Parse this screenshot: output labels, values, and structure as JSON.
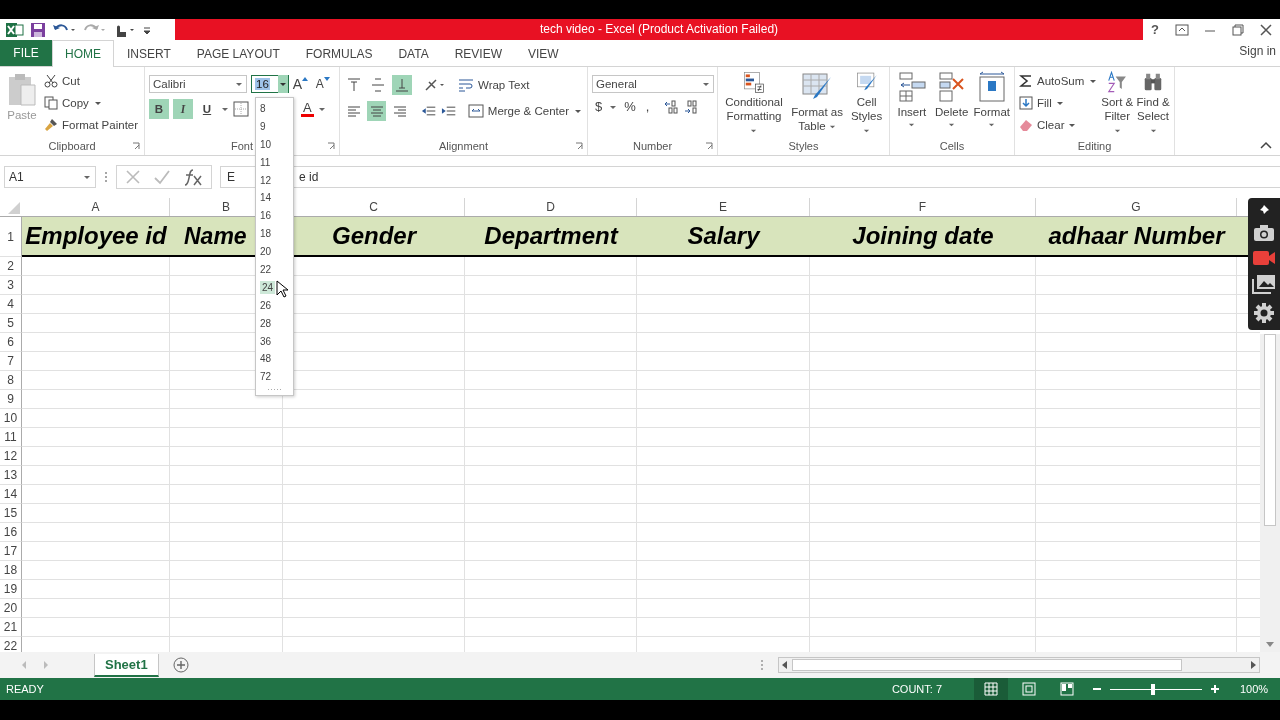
{
  "window": {
    "title": "tech video -  Excel (Product Activation Failed)",
    "help": "?"
  },
  "account": {
    "label": "Sign in"
  },
  "tabs": [
    {
      "label": "FILE",
      "kind": "file",
      "selected": false
    },
    {
      "label": "HOME",
      "kind": "tab",
      "selected": true
    },
    {
      "label": "INSERT",
      "kind": "tab",
      "selected": false
    },
    {
      "label": "PAGE LAYOUT",
      "kind": "tab",
      "selected": false
    },
    {
      "label": "FORMULAS",
      "kind": "tab",
      "selected": false
    },
    {
      "label": "DATA",
      "kind": "tab",
      "selected": false
    },
    {
      "label": "REVIEW",
      "kind": "tab",
      "selected": false
    },
    {
      "label": "VIEW",
      "kind": "tab",
      "selected": false
    }
  ],
  "clipboard": {
    "label": "Clipboard",
    "paste": "Paste",
    "cut": "Cut",
    "copy": "Copy",
    "format_painter": "Format Painter"
  },
  "font": {
    "label": "Font",
    "name": "Calibri",
    "size": "16",
    "grow": "A",
    "shrink": "A",
    "font_color": "A",
    "styles": [
      {
        "label": "B",
        "kind": "bold",
        "on": true
      },
      {
        "label": "I",
        "kind": "italic",
        "on": true
      },
      {
        "label": "U",
        "kind": "underline",
        "on": false
      }
    ]
  },
  "font_size_list": [
    {
      "label": "8",
      "selected": false
    },
    {
      "label": "9",
      "selected": false
    },
    {
      "label": "10",
      "selected": false
    },
    {
      "label": "11",
      "selected": false
    },
    {
      "label": "12",
      "selected": false
    },
    {
      "label": "14",
      "selected": false
    },
    {
      "label": "16",
      "selected": false
    },
    {
      "label": "18",
      "selected": false
    },
    {
      "label": "20",
      "selected": false
    },
    {
      "label": "22",
      "selected": false
    },
    {
      "label": "24",
      "selected": true
    },
    {
      "label": "26",
      "selected": false
    },
    {
      "label": "28",
      "selected": false
    },
    {
      "label": "36",
      "selected": false
    },
    {
      "label": "48",
      "selected": false
    },
    {
      "label": "72",
      "selected": false
    }
  ],
  "alignment": {
    "label": "Alignment",
    "wrap_text": "Wrap Text",
    "merge_center": "Merge & Center",
    "vertical": [
      {
        "kind": "top",
        "selected": false
      },
      {
        "kind": "middle",
        "selected": false
      },
      {
        "kind": "bottom",
        "selected": true
      }
    ],
    "horizontal": [
      {
        "kind": "left",
        "selected": false
      },
      {
        "kind": "center",
        "selected": true
      },
      {
        "kind": "right",
        "selected": false
      }
    ]
  },
  "number": {
    "label": "Number",
    "format": "General",
    "currency": "$",
    "percent": "%",
    "comma": ","
  },
  "styles": {
    "label": "Styles",
    "buttons": [
      {
        "label": "Conditional Formatting",
        "kind": "conditional"
      },
      {
        "label": "Format as Table",
        "kind": "table"
      },
      {
        "label": "Cell Styles",
        "kind": "cellstyles"
      }
    ]
  },
  "cells": {
    "label": "Cells",
    "buttons": [
      {
        "label": "Insert",
        "kind": "insert"
      },
      {
        "label": "Delete",
        "kind": "delete"
      },
      {
        "label": "Format",
        "kind": "format"
      }
    ]
  },
  "editing": {
    "label": "Editing",
    "autosum": "AutoSum",
    "fill": "Fill",
    "clear": "Clear",
    "sort_filter": "Sort & Filter",
    "find_select": "Find & Select"
  },
  "formula_bar": {
    "name_box": "A1",
    "value_parts": [
      "E",
      "e id"
    ]
  },
  "sheet": {
    "columns": [
      "A",
      "B",
      "C",
      "D",
      "E",
      "F",
      "G"
    ],
    "rows": [
      "1",
      "2",
      "3",
      "4",
      "5",
      "6",
      "7",
      "8",
      "9",
      "10",
      "11",
      "12",
      "13",
      "14",
      "15",
      "16",
      "17",
      "18",
      "19",
      "20",
      "21",
      "22"
    ],
    "header_cells": [
      "Employee id",
      "Name",
      "Gender",
      "Department",
      "Salary",
      "Joining date",
      "adhaar Number"
    ]
  },
  "sheet_tabs": [
    {
      "label": "Sheet1",
      "selected": true
    }
  ],
  "status_bar": {
    "mode": "READY",
    "count": "COUNT: 7",
    "zoom": "100%",
    "zoom_slider": {
      "level": 0.47
    },
    "views": [
      {
        "kind": "normal",
        "selected": true
      },
      {
        "kind": "page_layout",
        "selected": false
      },
      {
        "kind": "page_break",
        "selected": false
      }
    ]
  }
}
